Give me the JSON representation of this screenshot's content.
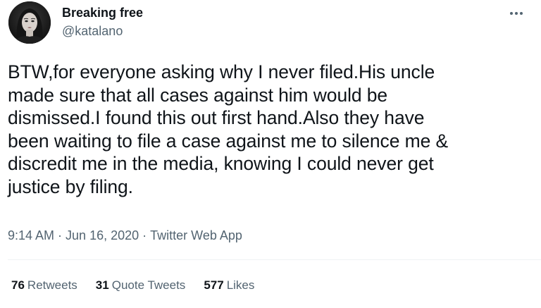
{
  "author": {
    "display_name": "Breaking free",
    "handle": "@katalano",
    "avatar_icon": "profile-photo"
  },
  "tweet": {
    "lines": [
      "BTW,for everyone asking why I never filed.His uncle",
      "made sure that all cases against him would be",
      "dismissed.I found this out first hand.Also they have",
      "been waiting to file a case against me to silence me &",
      "discredit me in the media, knowing I could never get",
      "justice by filing."
    ]
  },
  "meta": {
    "time": "9:14 AM",
    "separator": "·",
    "date": "Jun 16, 2020",
    "source": "Twitter Web App"
  },
  "stats": {
    "retweets": {
      "count": "76",
      "label": "Retweets"
    },
    "quote_tweets": {
      "count": "31",
      "label": "Quote Tweets"
    },
    "likes": {
      "count": "577",
      "label": "Likes"
    }
  },
  "icons": {
    "more": "more-horizontal-icon"
  },
  "colors": {
    "text_primary": "#0f1419",
    "text_secondary": "#536471",
    "divider": "#eff3f4"
  }
}
